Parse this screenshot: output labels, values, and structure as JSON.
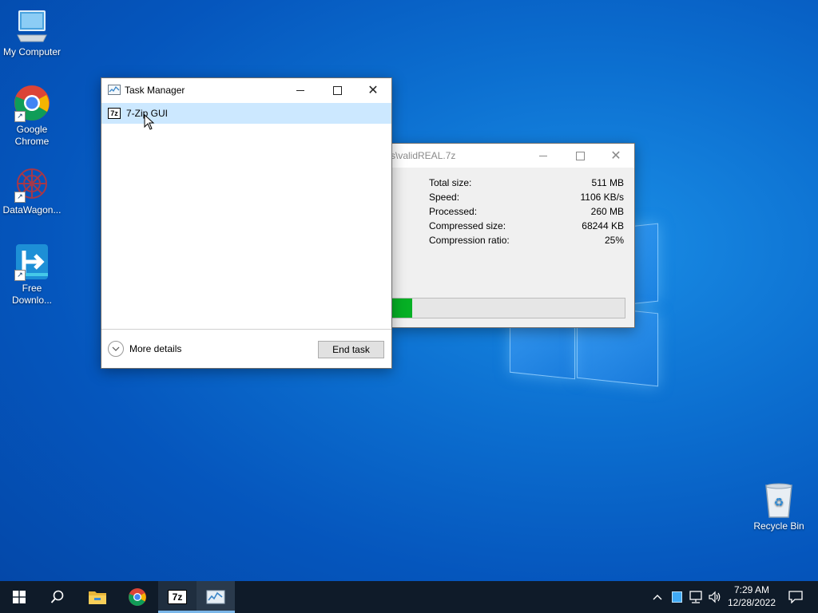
{
  "desktop": {
    "icons": [
      {
        "label": "My Computer"
      },
      {
        "label": "Google Chrome"
      },
      {
        "label": "DataWagon..."
      },
      {
        "label": "Free Downlo..."
      },
      {
        "label": "Recycle Bin"
      }
    ]
  },
  "task_manager": {
    "title": "Task Manager",
    "app_row": {
      "icon": "7z",
      "name": "7-Zip GUI"
    },
    "more_details": "More details",
    "end_task": "End task"
  },
  "zip_window": {
    "title": "s\\validREAL.7z",
    "stats": [
      {
        "label": "Total size:",
        "value": "511 MB"
      },
      {
        "label": "Speed:",
        "value": "1106 KB/s"
      },
      {
        "label": "Processed:",
        "value": "260 MB"
      },
      {
        "label": "Compressed size:",
        "value": "68244 KB"
      },
      {
        "label": "Compression ratio:",
        "value": "25%"
      }
    ],
    "progress_fraction": 0.09,
    "progress_color": "#06b025"
  },
  "taskbar": {
    "app_7z_label": "7z",
    "time": "7:29 AM",
    "date": "12/28/2022"
  },
  "colors": {
    "accent": "#0c6fd0",
    "taskbar": "#0f1b29",
    "selection": "#cce8ff"
  }
}
